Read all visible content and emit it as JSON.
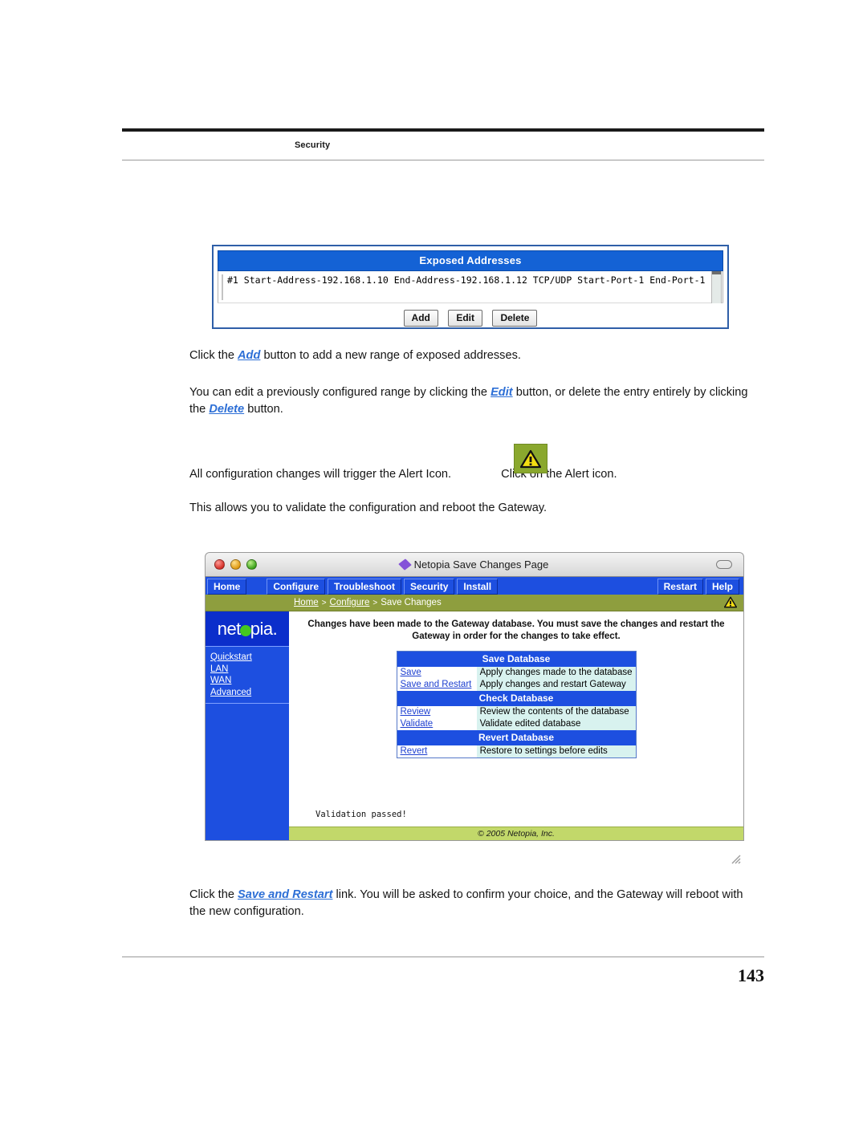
{
  "page": {
    "running_head": "Security",
    "page_number": "143"
  },
  "exposed_addresses": {
    "title": "Exposed Addresses",
    "entries": [
      "#1 Start-Address-192.168.1.10 End-Address-192.168.1.12 TCP/UDP Start-Port-1 End-Port-1"
    ],
    "buttons": [
      {
        "label": "Add"
      },
      {
        "label": "Edit"
      },
      {
        "label": "Delete"
      }
    ]
  },
  "body": {
    "p1_a": "Click the ",
    "p1_link": "Add",
    "p1_b": " button to add a new range of exposed addresses.",
    "p2_a": "You can edit a previously configured range by clicking the ",
    "p2_link1": "Edit",
    "p2_b": " button, or delete the entry entirely by clicking the ",
    "p2_link2": "Delete",
    "p2_c": " button.",
    "p3_a": "All configuration changes will trigger the Alert Icon.",
    "p3_b": "Click on the Alert icon.",
    "p4": "This allows you to validate the configuration and reboot the Gateway.",
    "p5_a": "Click the ",
    "p5_link": "Save and Restart",
    "p5_b": " link. You will be asked to confirm your choice, and the Gateway will reboot with the new configuration."
  },
  "browser": {
    "window_title": "Netopia Save Changes Page",
    "nav": {
      "left": [
        "Home"
      ],
      "middle": [
        "Configure",
        "Troubleshoot",
        "Security",
        "Install"
      ],
      "right": [
        "Restart",
        "Help"
      ]
    },
    "breadcrumb": {
      "item1": "Home",
      "sep1": ">",
      "item2": "Configure",
      "sep2": ">",
      "item3": "Save Changes"
    },
    "logo": {
      "pre": "net",
      "mid": "pia."
    },
    "sidebar": {
      "items": [
        "Quickstart",
        "LAN",
        "WAN",
        "Advanced"
      ]
    },
    "notice": "Changes have been made to the Gateway database. You must save the changes and restart the Gateway in order for the changes to take effect.",
    "tables": [
      {
        "header": "Save Database",
        "rows": [
          {
            "link": "Save",
            "desc": "Apply changes made to the database"
          },
          {
            "link": "Save and Restart",
            "desc": "Apply changes and restart Gateway"
          }
        ]
      },
      {
        "header": "Check Database",
        "rows": [
          {
            "link": "Review",
            "desc": "Review the contents of the database"
          },
          {
            "link": "Validate",
            "desc": "Validate edited database"
          }
        ]
      },
      {
        "header": "Revert Database",
        "rows": [
          {
            "link": "Revert",
            "desc": "Restore to settings before edits"
          }
        ]
      }
    ],
    "validation_message": "Validation passed!",
    "copyright": "© 2005 Netopia, Inc."
  },
  "colors": {
    "nav_blue": "#1d4fe0",
    "breadcrumb_olive": "#8e9e3e",
    "footer_olive": "#c2d86a",
    "table_desc_cyan": "#d8f2ef",
    "link_blue": "#2d6fd6",
    "alert_green": "#8aa82e",
    "alert_yellow": "#f2dd12"
  }
}
